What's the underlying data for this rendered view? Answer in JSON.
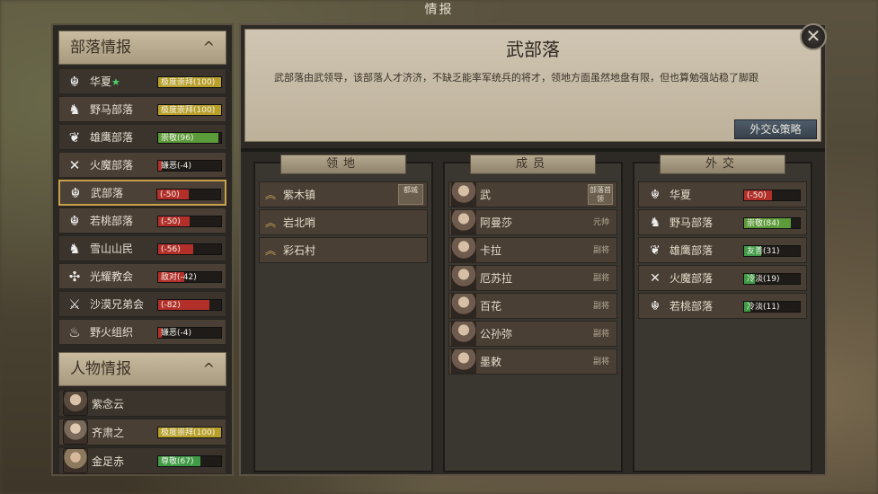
{
  "window": {
    "title": "情报"
  },
  "left": {
    "tribe_section": {
      "title": "部落情报",
      "chevron": "^"
    },
    "tribes": [
      {
        "name": "华夏",
        "star": "★",
        "emblem": "☬",
        "relation": "极度崇拜(100)",
        "level": 1.0,
        "color": "#b9a02b"
      },
      {
        "name": "野马部落",
        "star": "",
        "emblem": "♞",
        "relation": "极度崇拜(100)",
        "level": 1.0,
        "color": "#b9a02b"
      },
      {
        "name": "雄鹰部落",
        "star": "",
        "emblem": "❦",
        "relation": "崇敬(96)",
        "level": 0.96,
        "color": "#5c9b3a"
      },
      {
        "name": "火魔部落",
        "star": "",
        "emblem": "✕",
        "relation": "嫌恶(-4)",
        "level": 0.05,
        "color": "#b3302a"
      },
      {
        "name": "武部落",
        "star": "",
        "emblem": "☬",
        "relation": "(-50)",
        "level": 0.5,
        "color": "#b3302a"
      },
      {
        "name": "若桃部落",
        "star": "",
        "emblem": "☬",
        "relation": "(-50)",
        "level": 0.5,
        "color": "#b3302a"
      },
      {
        "name": "雪山山民",
        "star": "",
        "emblem": "♞",
        "relation": "(-56)",
        "level": 0.56,
        "color": "#b3302a"
      },
      {
        "name": "光耀教会",
        "star": "",
        "emblem": "✣",
        "relation": "敌对(-42)",
        "level": 0.42,
        "color": "#b3302a"
      },
      {
        "name": "沙漠兄弟会",
        "star": "",
        "emblem": "⚔",
        "relation": "(-82)",
        "level": 0.82,
        "color": "#b3302a"
      },
      {
        "name": "野火组织",
        "star": "",
        "emblem": "♨",
        "relation": "嫌恶(-4)",
        "level": 0.05,
        "color": "#b3302a"
      }
    ],
    "person_section": {
      "title": "人物情报",
      "chevron": "^"
    },
    "persons": [
      {
        "name": "紫念云",
        "relation": "",
        "level": 0,
        "color": ""
      },
      {
        "name": "齐肃之",
        "relation": "极度崇拜(100)",
        "level": 1.0,
        "color": "#b9a02b"
      },
      {
        "name": "金足赤",
        "relation": "尊敬(67)",
        "level": 0.67,
        "color": "#3f9b46"
      }
    ]
  },
  "main": {
    "title": "武部落",
    "description": "武部落由武领导，该部落人才济济，不缺乏能率军统兵的将才，领地方面虽然地盘有限，但也算勉强站稳了脚跟",
    "diplomacy_button": "外交&策略",
    "close_icon": "✕",
    "territory": {
      "title": "领地",
      "items": [
        {
          "name": "紫木镇",
          "tag": "都城"
        },
        {
          "name": "岩北哨",
          "tag": ""
        },
        {
          "name": "彩石村",
          "tag": ""
        }
      ]
    },
    "members": {
      "title": "成员",
      "items": [
        {
          "name": "武",
          "rank": "部落首领"
        },
        {
          "name": "阿曼莎",
          "rank": "元帅"
        },
        {
          "name": "卡拉",
          "rank": "副将"
        },
        {
          "name": "厄苏拉",
          "rank": "副将"
        },
        {
          "name": "百花",
          "rank": "副将"
        },
        {
          "name": "公孙弥",
          "rank": "副将"
        },
        {
          "name": "墨敕",
          "rank": "副将"
        }
      ]
    },
    "diplomacy": {
      "title": "外交",
      "items": [
        {
          "name": "华夏",
          "emblem": "☬",
          "relation": "(-50)",
          "level": 0.5,
          "color": "#b3302a"
        },
        {
          "name": "野马部落",
          "emblem": "♞",
          "relation": "崇敬(84)",
          "level": 0.84,
          "color": "#5c9b3a"
        },
        {
          "name": "雄鹰部落",
          "emblem": "❦",
          "relation": "友善(31)",
          "level": 0.31,
          "color": "#3f9b46"
        },
        {
          "name": "火魔部落",
          "emblem": "✕",
          "relation": "冷淡(19)",
          "level": 0.19,
          "color": "#3f9b46"
        },
        {
          "name": "若桃部落",
          "emblem": "☬",
          "relation": "冷淡(11)",
          "level": 0.11,
          "color": "#3f9b46"
        }
      ]
    }
  }
}
